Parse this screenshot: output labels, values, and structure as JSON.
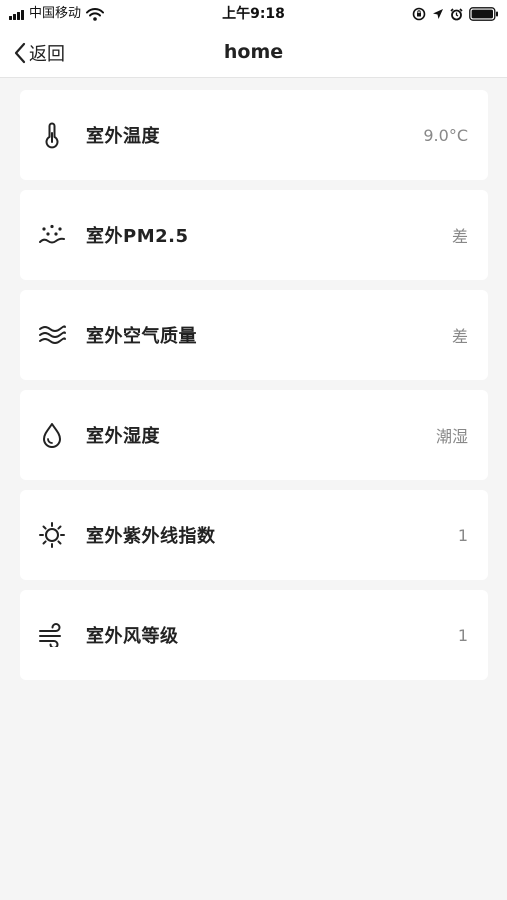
{
  "status_bar": {
    "carrier": "中国移动",
    "time": "上午9:18",
    "icons": [
      "signal-icon",
      "wifi-icon",
      "orientation-lock-icon",
      "location-icon",
      "alarm-icon",
      "battery-icon"
    ]
  },
  "nav": {
    "back_label": "返回",
    "title": "home"
  },
  "items": [
    {
      "icon": "thermometer-icon",
      "label": "室外温度",
      "value": "9.0°C"
    },
    {
      "icon": "pm25-icon",
      "label": "室外PM2.5",
      "value": "差"
    },
    {
      "icon": "air-quality-icon",
      "label": "室外空气质量",
      "value": "差"
    },
    {
      "icon": "humidity-drop-icon",
      "label": "室外湿度",
      "value": "潮湿"
    },
    {
      "icon": "sun-uv-icon",
      "label": "室外紫外线指数",
      "value": "1"
    },
    {
      "icon": "wind-icon",
      "label": "室外风等级",
      "value": "1"
    }
  ],
  "colors": {
    "background": "#f5f5f5",
    "card": "#ffffff",
    "label": "#222222",
    "value": "#888888"
  }
}
